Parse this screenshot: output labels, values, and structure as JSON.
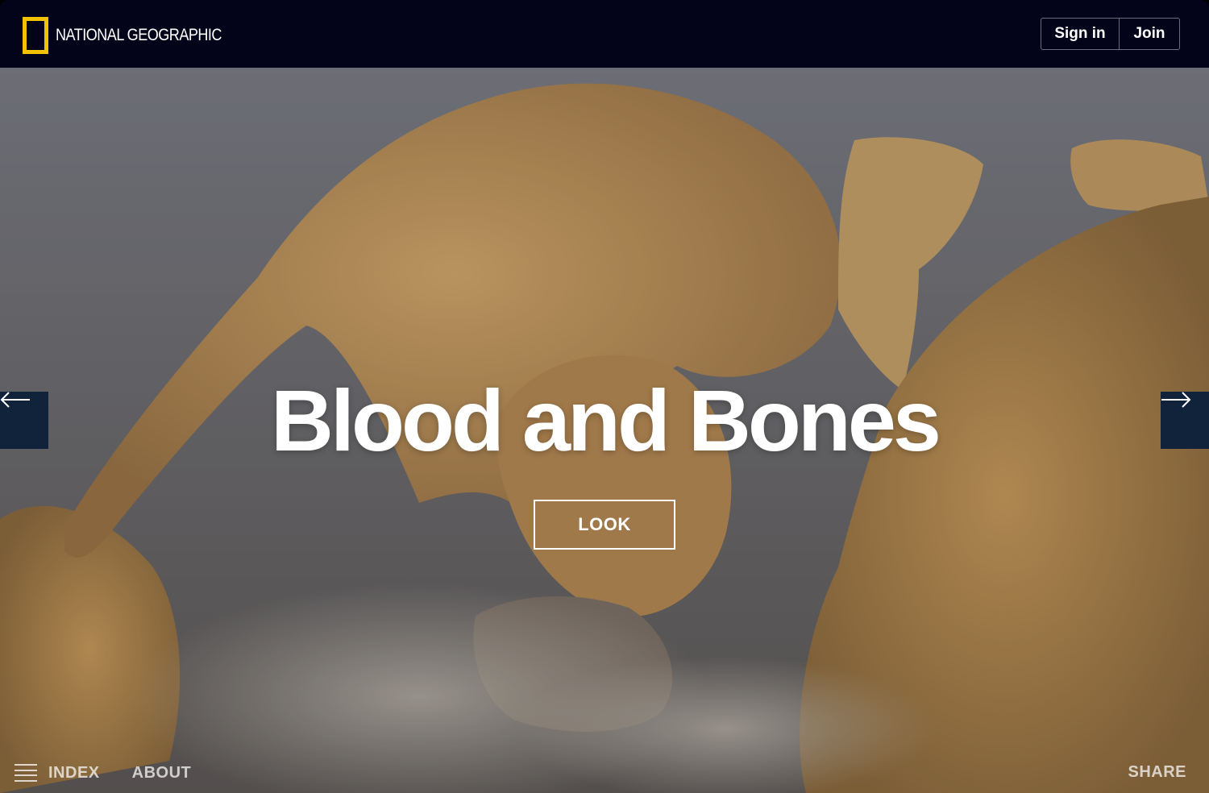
{
  "header": {
    "logo_text": "NATIONAL GEOGRAPHIC",
    "sign_in_label": "Sign in",
    "join_label": "Join",
    "brand_yellow": "#f4c300",
    "background": "#03041a"
  },
  "hero": {
    "title": "Blood and Bones",
    "cta_label": "LOOK",
    "image_description_icon": "lions-photo",
    "prev_icon": "arrow-left-icon",
    "next_icon": "arrow-right-icon",
    "arrow_bg": "#10233b"
  },
  "footer": {
    "index_label": "INDEX",
    "about_label": "ABOUT",
    "share_label": "SHARE",
    "menu_icon": "hamburger-icon"
  }
}
